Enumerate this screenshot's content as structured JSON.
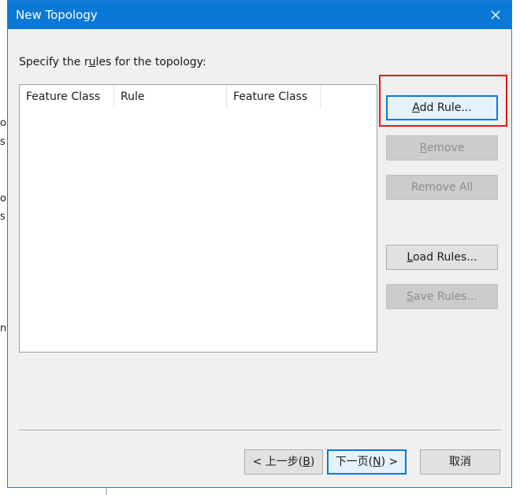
{
  "dialog": {
    "title": "New Topology",
    "close_icon": "close-icon",
    "prompt_before": "Specify the r",
    "prompt_accel": "u",
    "prompt_after": "les for the topology:"
  },
  "rules_table": {
    "columns": [
      "Feature Class",
      "Rule",
      "Feature Class",
      ""
    ],
    "rows": []
  },
  "buttons": {
    "add_rule": {
      "accel": "A",
      "rest": "dd Rule...",
      "enabled": true
    },
    "remove": {
      "accel": "R",
      "rest": "emove",
      "enabled": false
    },
    "remove_all": {
      "label": "Remove All",
      "enabled": false
    },
    "load_rules": {
      "accel": "L",
      "rest": "oad Rules...",
      "enabled": true
    },
    "save_rules": {
      "accel": "S",
      "rest": "ave Rules...",
      "enabled": false
    }
  },
  "footer": {
    "back": {
      "prefix": "< 上一步(",
      "accel": "B",
      "suffix": ")"
    },
    "next": {
      "prefix": "下一页(",
      "accel": "N",
      "suffix": ") >"
    },
    "cancel": "取消"
  },
  "background_fragments": [
    "ol",
    "s",
    "o",
    "s",
    "n"
  ],
  "colors": {
    "title_bar": "#0a78d7",
    "highlight": "#e0191f",
    "dialog_bg": "#f0f0f0"
  }
}
